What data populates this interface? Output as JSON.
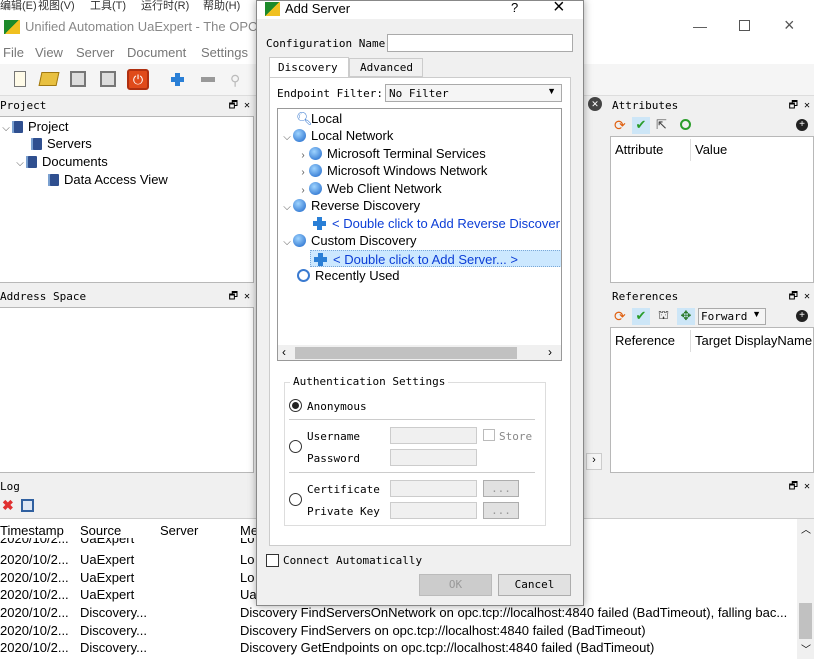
{
  "system_menu": {
    "items": [
      "编辑(E)",
      "视图(V)",
      "工具(T)",
      "运行时(R)",
      "帮助(H)"
    ]
  },
  "main_window": {
    "title": "Unified Automation UaExpert - The OPC",
    "menu": [
      "File",
      "View",
      "Server",
      "Document",
      "Settings"
    ]
  },
  "project_panel": {
    "title": "Project",
    "tree": [
      "Project",
      "Servers",
      "Documents",
      "Data Access View"
    ]
  },
  "address_space_panel": {
    "title": "Address Space"
  },
  "attributes_panel": {
    "title": "Attributes",
    "columns": [
      "Attribute",
      "Value"
    ]
  },
  "references_panel": {
    "title": "References",
    "direction": "Forward",
    "columns": [
      "Reference",
      "Target DisplayName"
    ]
  },
  "log_panel": {
    "title": "Log",
    "columns": [
      "Timestamp",
      "Source",
      "Server",
      "Me"
    ],
    "rows": [
      {
        "timestamp": "2020/10/2...",
        "source": "UaExpert",
        "message": "Lo"
      },
      {
        "timestamp": "2020/10/2...",
        "source": "UaExpert",
        "message": "Lo"
      },
      {
        "timestamp": "2020/10/2...",
        "source": "UaExpert",
        "message": "Lo"
      },
      {
        "timestamp": "2020/10/2...",
        "source": "UaExpert",
        "message": "Ua"
      },
      {
        "timestamp": "2020/10/2...",
        "source": "Discovery...",
        "message": "Discovery FindServersOnNetwork on opc.tcp://localhost:4840 failed (BadTimeout), falling bac..."
      },
      {
        "timestamp": "2020/10/2...",
        "source": "Discovery...",
        "message": "Discovery FindServers on opc.tcp://localhost:4840 failed (BadTimeout)"
      },
      {
        "timestamp": "2020/10/2...",
        "source": "Discovery...",
        "message": "Discovery GetEndpoints on opc.tcp://localhost:4840 failed (BadTimeout)"
      }
    ]
  },
  "dialog": {
    "title": "Add Server",
    "help_glyph": "?",
    "close_glyph": "×",
    "config_name_label": "Configuration Name",
    "config_name_value": "",
    "tabs": [
      "Discovery",
      "Advanced"
    ],
    "endpoint_filter_label": "Endpoint Filter:",
    "endpoint_filter_value": "No Filter",
    "tree": {
      "local": "Local",
      "local_network": "Local Network",
      "ms_terminal": "Microsoft Terminal Services",
      "ms_windows_network": "Microsoft Windows Network",
      "web_client_network": "Web Client Network",
      "reverse_discovery": "Reverse Discovery",
      "add_reverse": "< Double click to Add Reverse Discover",
      "custom_discovery": "Custom Discovery",
      "add_server": "< Double click to Add Server... >",
      "recently_used": "Recently Used"
    },
    "auth": {
      "title": "Authentication Settings",
      "anonymous": "Anonymous",
      "username": "Username",
      "password": "Password",
      "store": "Store",
      "certificate": "Certificate",
      "private_key": "Private Key",
      "browse": "..."
    },
    "connect_automatically": "Connect Automatically",
    "ok": "OK",
    "cancel": "Cancel"
  },
  "colors": {
    "selection": "#cce8ff",
    "link_blue": "#0b3dd6",
    "close_red": "#e03030"
  }
}
